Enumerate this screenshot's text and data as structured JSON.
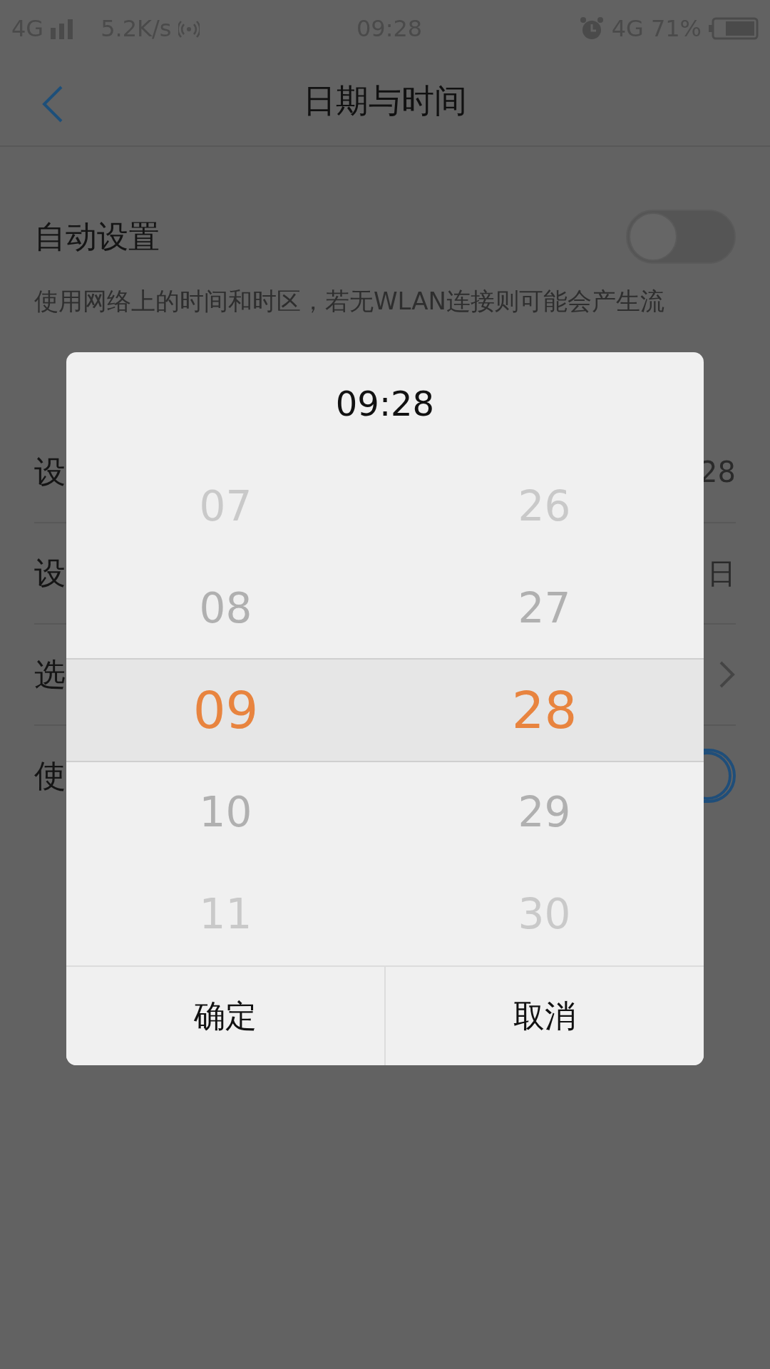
{
  "status_bar": {
    "network": "4G",
    "speed": "5.2K/s",
    "time": "09:28",
    "data_network": "4G",
    "battery": "71%"
  },
  "header": {
    "title": "日期与时间"
  },
  "auto_setting": {
    "label": "自动设置",
    "on": false,
    "description": "使用网络上的时间和时区，若无WLAN连接则可能会产生流"
  },
  "rows": [
    {
      "kind": "value",
      "label": "设",
      "value": "28"
    },
    {
      "kind": "value",
      "label": "设",
      "value": "日"
    },
    {
      "kind": "chevron",
      "label": "选"
    },
    {
      "kind": "toggle",
      "label": "使",
      "on": true
    }
  ],
  "dialog": {
    "title": "09:28",
    "columns": [
      {
        "items": [
          {
            "text": "07",
            "selected": false
          },
          {
            "text": "08",
            "selected": false
          },
          {
            "text": "09",
            "selected": true
          },
          {
            "text": "10",
            "selected": false
          },
          {
            "text": "11",
            "selected": false
          }
        ]
      },
      {
        "items": [
          {
            "text": "26",
            "selected": false
          },
          {
            "text": "27",
            "selected": false
          },
          {
            "text": "28",
            "selected": true
          },
          {
            "text": "29",
            "selected": false
          },
          {
            "text": "30",
            "selected": false
          }
        ]
      }
    ],
    "buttons": [
      "确定",
      "取消"
    ]
  }
}
